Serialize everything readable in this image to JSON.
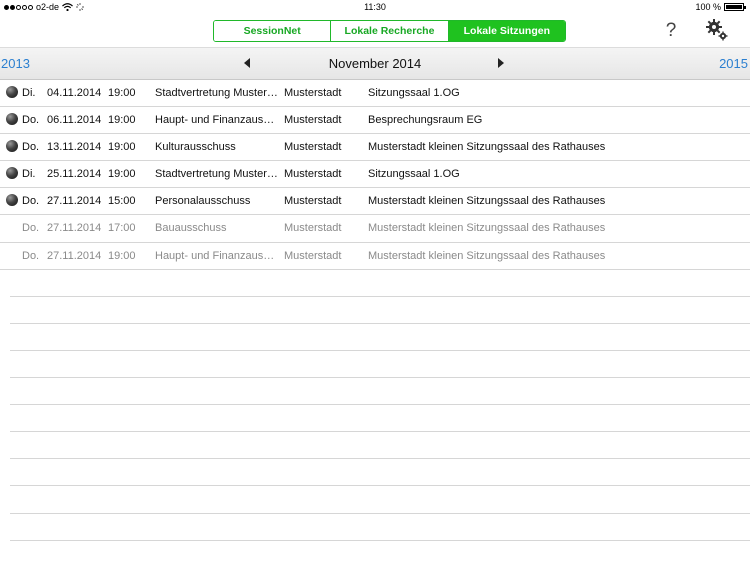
{
  "status_bar": {
    "carrier": "o2-de",
    "time": "11:30",
    "battery": "100 %",
    "battery_level": 1.0,
    "signal_bars": 2
  },
  "toolbar": {
    "segments": [
      {
        "label": "SessionNet",
        "active": false
      },
      {
        "label": "Lokale Recherche",
        "active": false
      },
      {
        "label": "Lokale Sitzungen",
        "active": true
      }
    ],
    "help_label": "?",
    "accent_color": "#1fc21f"
  },
  "month_nav": {
    "prev_year": "2013",
    "month": "November 2014",
    "next_year": "2015",
    "link_color": "#2b7fd0"
  },
  "meetings": [
    {
      "past": true,
      "day": "Di.",
      "date": "04.11.2014",
      "time": "19:00",
      "committee": "Stadtvertretung Muster…",
      "city": "Musterstadt",
      "room": "Sitzungssaal 1.OG"
    },
    {
      "past": true,
      "day": "Do.",
      "date": "06.11.2014",
      "time": "19:00",
      "committee": "Haupt- und Finanzaus…",
      "city": "Musterstadt",
      "room": "Besprechungsraum EG"
    },
    {
      "past": true,
      "day": "Do.",
      "date": "13.11.2014",
      "time": "19:00",
      "committee": "Kulturausschuss",
      "city": "Musterstadt",
      "room": "Musterstadt kleinen Sitzungssaal des Rathauses"
    },
    {
      "past": true,
      "day": "Di.",
      "date": "25.11.2014",
      "time": "19:00",
      "committee": "Stadtvertretung Muster…",
      "city": "Musterstadt",
      "room": "Sitzungssaal 1.OG"
    },
    {
      "past": true,
      "day": "Do.",
      "date": "27.11.2014",
      "time": "15:00",
      "committee": "Personalausschuss",
      "city": "Musterstadt",
      "room": "Musterstadt kleinen Sitzungssaal des Rathauses"
    },
    {
      "past": false,
      "day": "Do.",
      "date": "27.11.2014",
      "time": "17:00",
      "committee": "Bauausschuss",
      "city": "Musterstadt",
      "room": "Musterstadt kleinen Sitzungssaal des Rathauses"
    },
    {
      "past": false,
      "day": "Do.",
      "date": "27.11.2014",
      "time": "19:00",
      "committee": "Haupt- und Finanzaus…",
      "city": "Musterstadt",
      "room": "Musterstadt kleinen Sitzungssaal des Rathauses"
    }
  ]
}
